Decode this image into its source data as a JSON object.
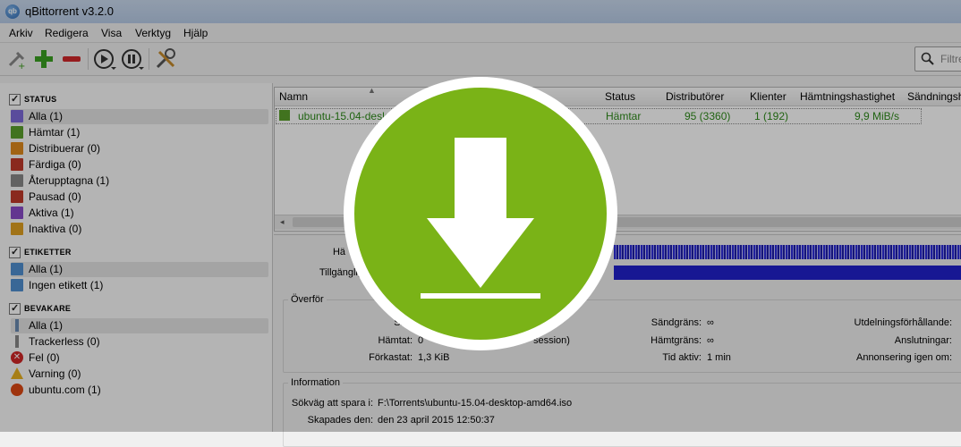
{
  "window": {
    "title": "qBittorrent v3.2.0",
    "icon": "qb-app-icon"
  },
  "menu": [
    "Arkiv",
    "Redigera",
    "Visa",
    "Verktyg",
    "Hjälp"
  ],
  "toolbar": {
    "filter_placeholder": "Filtre"
  },
  "sidebar": {
    "status": {
      "title": "Status",
      "items": [
        {
          "label": "Alla (1)",
          "icon": "all-icon",
          "color": "#7d6ad8"
        },
        {
          "label": "Hämtar (1)",
          "icon": "download-icon",
          "color": "#5aa02c"
        },
        {
          "label": "Distribuerar (0)",
          "icon": "upload-icon",
          "color": "#e08a1c"
        },
        {
          "label": "Färdiga (0)",
          "icon": "finished-icon",
          "color": "#c03a2a"
        },
        {
          "label": "Återupptagna (1)",
          "icon": "resumed-icon",
          "color": "#888888"
        },
        {
          "label": "Pausad (0)",
          "icon": "paused-icon",
          "color": "#c03a2a"
        },
        {
          "label": "Aktiva (1)",
          "icon": "active-icon",
          "color": "#8a4cc8"
        },
        {
          "label": "Inaktiva (0)",
          "icon": "inactive-icon",
          "color": "#e0a020"
        }
      ]
    },
    "labels": {
      "title": "Etiketter",
      "items": [
        {
          "label": "Alla (1)",
          "icon": "folder-icon"
        },
        {
          "label": "Ingen etikett (1)",
          "icon": "folder-icon"
        }
      ]
    },
    "trackers": {
      "title": "Bevakare",
      "items": [
        {
          "label": "Alla (1)",
          "icon": "tracker-icon"
        },
        {
          "label": "Trackerless (0)",
          "icon": "tracker-icon"
        },
        {
          "label": "Fel (0)",
          "icon": "error-icon"
        },
        {
          "label": "Varning (0)",
          "icon": "warning-icon"
        },
        {
          "label": "ubuntu.com (1)",
          "icon": "ubuntu-icon"
        }
      ]
    }
  },
  "columns": [
    "Namn",
    "Status",
    "Distributörer",
    "Klienter",
    "Hämtningshastighet",
    "Sändningsh"
  ],
  "torrent": {
    "name": "ubuntu-15.04-desk",
    "status": "Hämtar",
    "seeds": "95 (3360)",
    "peers": "1 (192)",
    "dl_speed": "9,9 MiB/s"
  },
  "details": {
    "progress_label": "Hä",
    "avail_label": "Tillgänglig",
    "transfer": {
      "title": "Överför",
      "rows": [
        {
          "label": "Skic",
          "value": ""
        },
        {
          "label": "Hämtat:",
          "value": "0"
        },
        {
          "label": "Förkastat:",
          "value": "1,3 KiB"
        }
      ],
      "session_fragment": "session)",
      "mid": [
        {
          "label": "Sändgräns:",
          "value": "∞"
        },
        {
          "label": "Hämtgräns:",
          "value": "∞"
        },
        {
          "label": "Tid aktiv:",
          "value": "1 min"
        }
      ],
      "right": [
        {
          "label": "Utdelningsförhållande:",
          "value": ""
        },
        {
          "label": "Anslutningar:",
          "value": ""
        },
        {
          "label": "Annonsering igen om:",
          "value": ""
        }
      ]
    },
    "info": {
      "title": "Information",
      "save_path_label": "Sökväg att spara i:",
      "save_path": "F:\\Torrents\\ubuntu-15.04-desktop-amd64.iso",
      "created_label": "Skapades den:",
      "created": "den 23 april 2015 12:50:37"
    }
  },
  "overlay": {
    "icon": "download-arrow-icon",
    "color": "#7ab317"
  }
}
